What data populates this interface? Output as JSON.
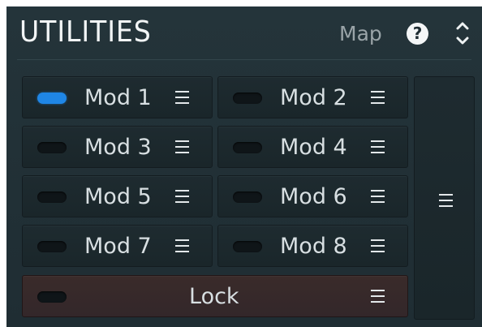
{
  "header": {
    "title": "UTILITIES",
    "map_label": "Map",
    "help_label": "?"
  },
  "mods": [
    {
      "label": "Mod 1",
      "active": true
    },
    {
      "label": "Mod 2",
      "active": false
    },
    {
      "label": "Mod 3",
      "active": false
    },
    {
      "label": "Mod 4",
      "active": false
    },
    {
      "label": "Mod 5",
      "active": false
    },
    {
      "label": "Mod 6",
      "active": false
    },
    {
      "label": "Mod 7",
      "active": false
    },
    {
      "label": "Mod 8",
      "active": false
    }
  ],
  "lock": {
    "label": "Lock",
    "active": false
  },
  "colors": {
    "panel_bg": "#24343a",
    "led_on": "#1f86e6",
    "lock_bg": "#3a2b2a"
  }
}
